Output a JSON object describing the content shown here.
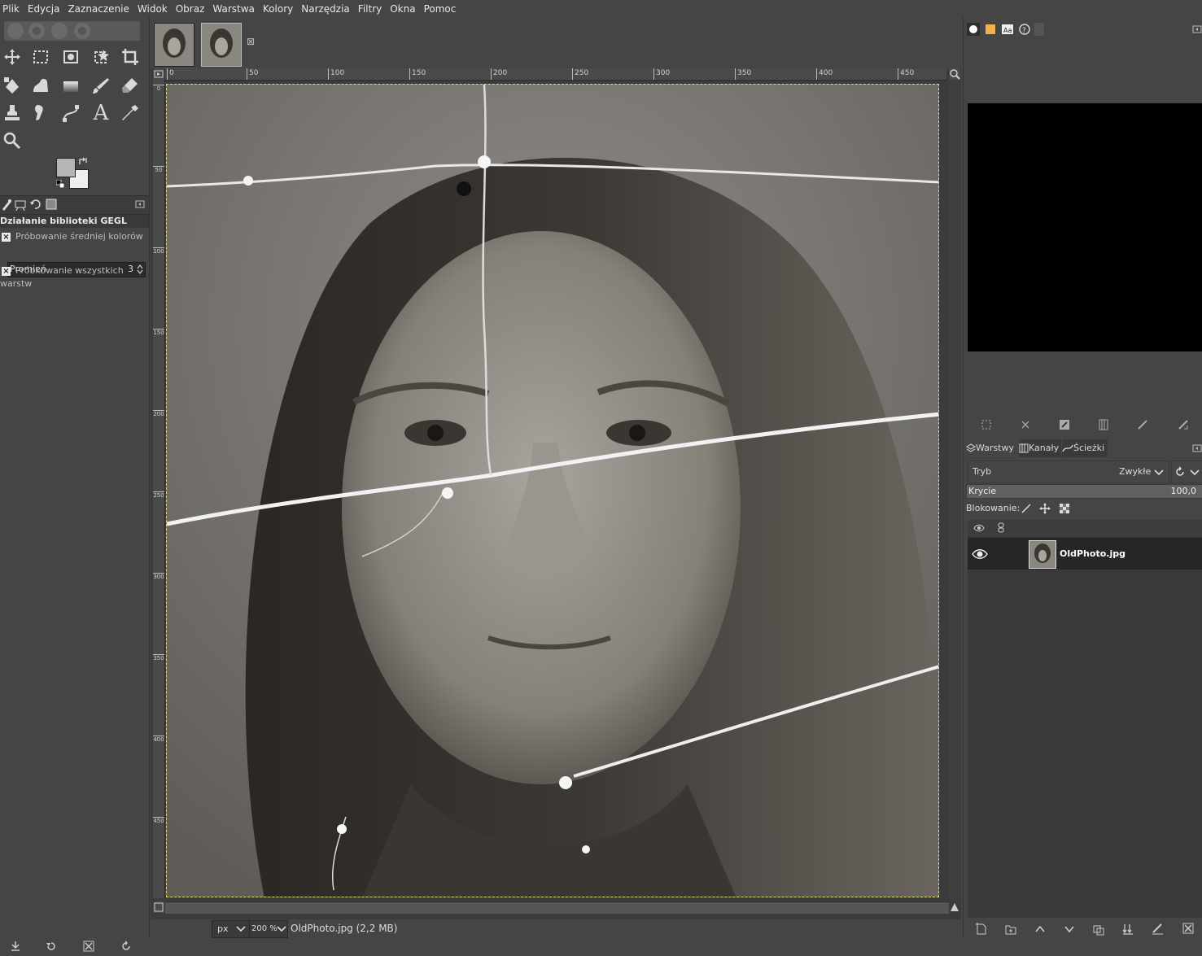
{
  "menubar": {
    "items": [
      "Plik",
      "Edycja",
      "Zaznaczenie",
      "Widok",
      "Obraz",
      "Warstwa",
      "Kolory",
      "Narzędzia",
      "Filtry",
      "Okna",
      "Pomoc"
    ]
  },
  "toolbox": {
    "tools": [
      "move-tool",
      "rect-select-tool",
      "scissors-select-tool",
      "fuzzy-select-tool",
      "crop-tool",
      "unified-transform-tool",
      "warp-tool",
      "gradient-tool",
      "paintbrush-tool",
      "eraser-tool",
      "clone-tool",
      "smudge-tool",
      "paths-tool",
      "text-tool",
      "color-picker-tool",
      "zoom-tool"
    ],
    "text_tool_glyph": "A"
  },
  "tool_options": {
    "title": "Działanie biblioteki GEGL",
    "sample_average_label": "Próbowanie średniej kolorów",
    "radius_label": "Promień",
    "radius_value": "3",
    "sample_merged_label": "Próbkowanie wszystkich warstw",
    "check_glyph": "×"
  },
  "image_tabs": {
    "close_glyph": "⊠"
  },
  "ruler": {
    "h_labels": [
      "0",
      "50",
      "100",
      "150",
      "200",
      "250",
      "300",
      "350",
      "400",
      "450"
    ],
    "v_labels": [
      "0",
      "50",
      "100",
      "150",
      "200",
      "250",
      "300",
      "350",
      "400",
      "450"
    ]
  },
  "status": {
    "unit": "px",
    "zoom": "200 %",
    "file_info": "OldPhoto.jpg (2,2 MB)"
  },
  "layers_panel": {
    "tabs": [
      "Warstwy",
      "Kanały",
      "Ścieżki"
    ],
    "mode_label": "Tryb",
    "mode_value": "Zwykłe",
    "opacity_label": "Krycie",
    "opacity_value": "100,0",
    "opacity_fraction": 1.0,
    "lock_label": "Blokowanie:",
    "layers": [
      {
        "name": "OldPhoto.jpg",
        "visible": true
      }
    ]
  },
  "colors": {
    "foreground": "#b5b5b5",
    "background": "#f0f0f0",
    "ui_bg": "#454545",
    "selection_border": "#e0d86a"
  }
}
